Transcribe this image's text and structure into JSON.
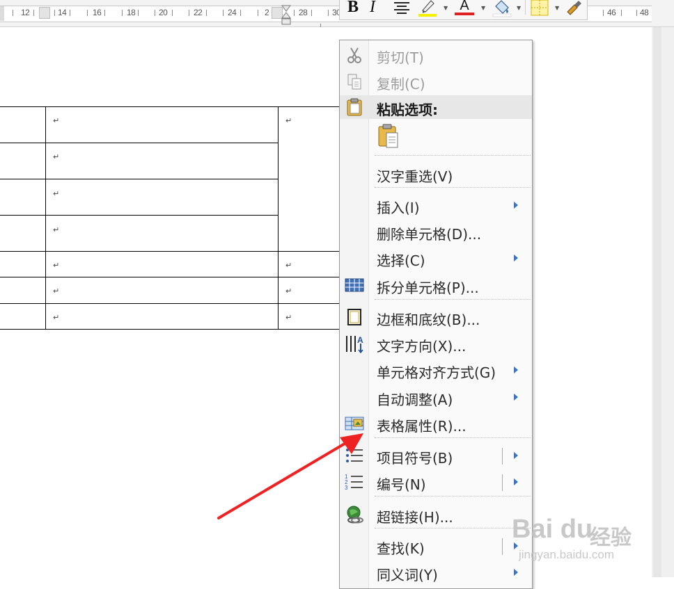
{
  "ruler": {
    "numbers": [
      "12",
      "14",
      "16",
      "18",
      "20",
      "22",
      "24",
      "2",
      "28",
      "30",
      "46",
      "48"
    ]
  },
  "mini_toolbar": {
    "bold_label": "B",
    "italic_label": "I",
    "icons": [
      "bold-icon",
      "italic-icon",
      "center-align-icon",
      "highlight-icon",
      "font-color-icon",
      "shading-icon",
      "borders-icon",
      "format-painter-icon"
    ],
    "highlight_color": "#f5f000",
    "font_color": "#e02020",
    "font_color_label": "A"
  },
  "document": {
    "cell_mark": "↵"
  },
  "context_menu": {
    "items": [
      {
        "label": "剪切(T)",
        "icon": "scissors-icon",
        "disabled": true
      },
      {
        "label": "复制(C)",
        "icon": "copy-icon",
        "disabled": true
      },
      {
        "label": "粘贴选项:",
        "icon": "paste-icon",
        "header": true
      },
      {
        "label": "汉字重选(V)"
      },
      {
        "label": "插入(I)",
        "submenu": true
      },
      {
        "label": "删除单元格(D)..."
      },
      {
        "label": "选择(C)",
        "submenu": true
      },
      {
        "label": "拆分单元格(P)...",
        "icon": "split-cells-icon"
      },
      {
        "label": "边框和底纹(B)...",
        "icon": "borders-shading-icon"
      },
      {
        "label": "文字方向(X)...",
        "icon": "text-direction-icon"
      },
      {
        "label": "单元格对齐方式(G)",
        "submenu": true
      },
      {
        "label": "自动调整(A)",
        "submenu": true
      },
      {
        "label": "表格属性(R)...",
        "icon": "table-properties-icon"
      },
      {
        "label": "项目符号(B)",
        "icon": "bullets-icon",
        "submenu": true
      },
      {
        "label": "编号(N)",
        "icon": "numbering-icon",
        "submenu": true
      },
      {
        "label": "超链接(H)...",
        "icon": "hyperlink-icon"
      },
      {
        "label": "查找(K)",
        "submenu": true
      },
      {
        "label": "同义词(Y)",
        "submenu": true
      }
    ],
    "accent_color": "#3a74c7"
  },
  "watermark": {
    "logo": "Bai du",
    "cn": "经验",
    "url": "jingyan.baidu.com"
  },
  "annotation": {
    "arrow_color": "#ee2222"
  }
}
